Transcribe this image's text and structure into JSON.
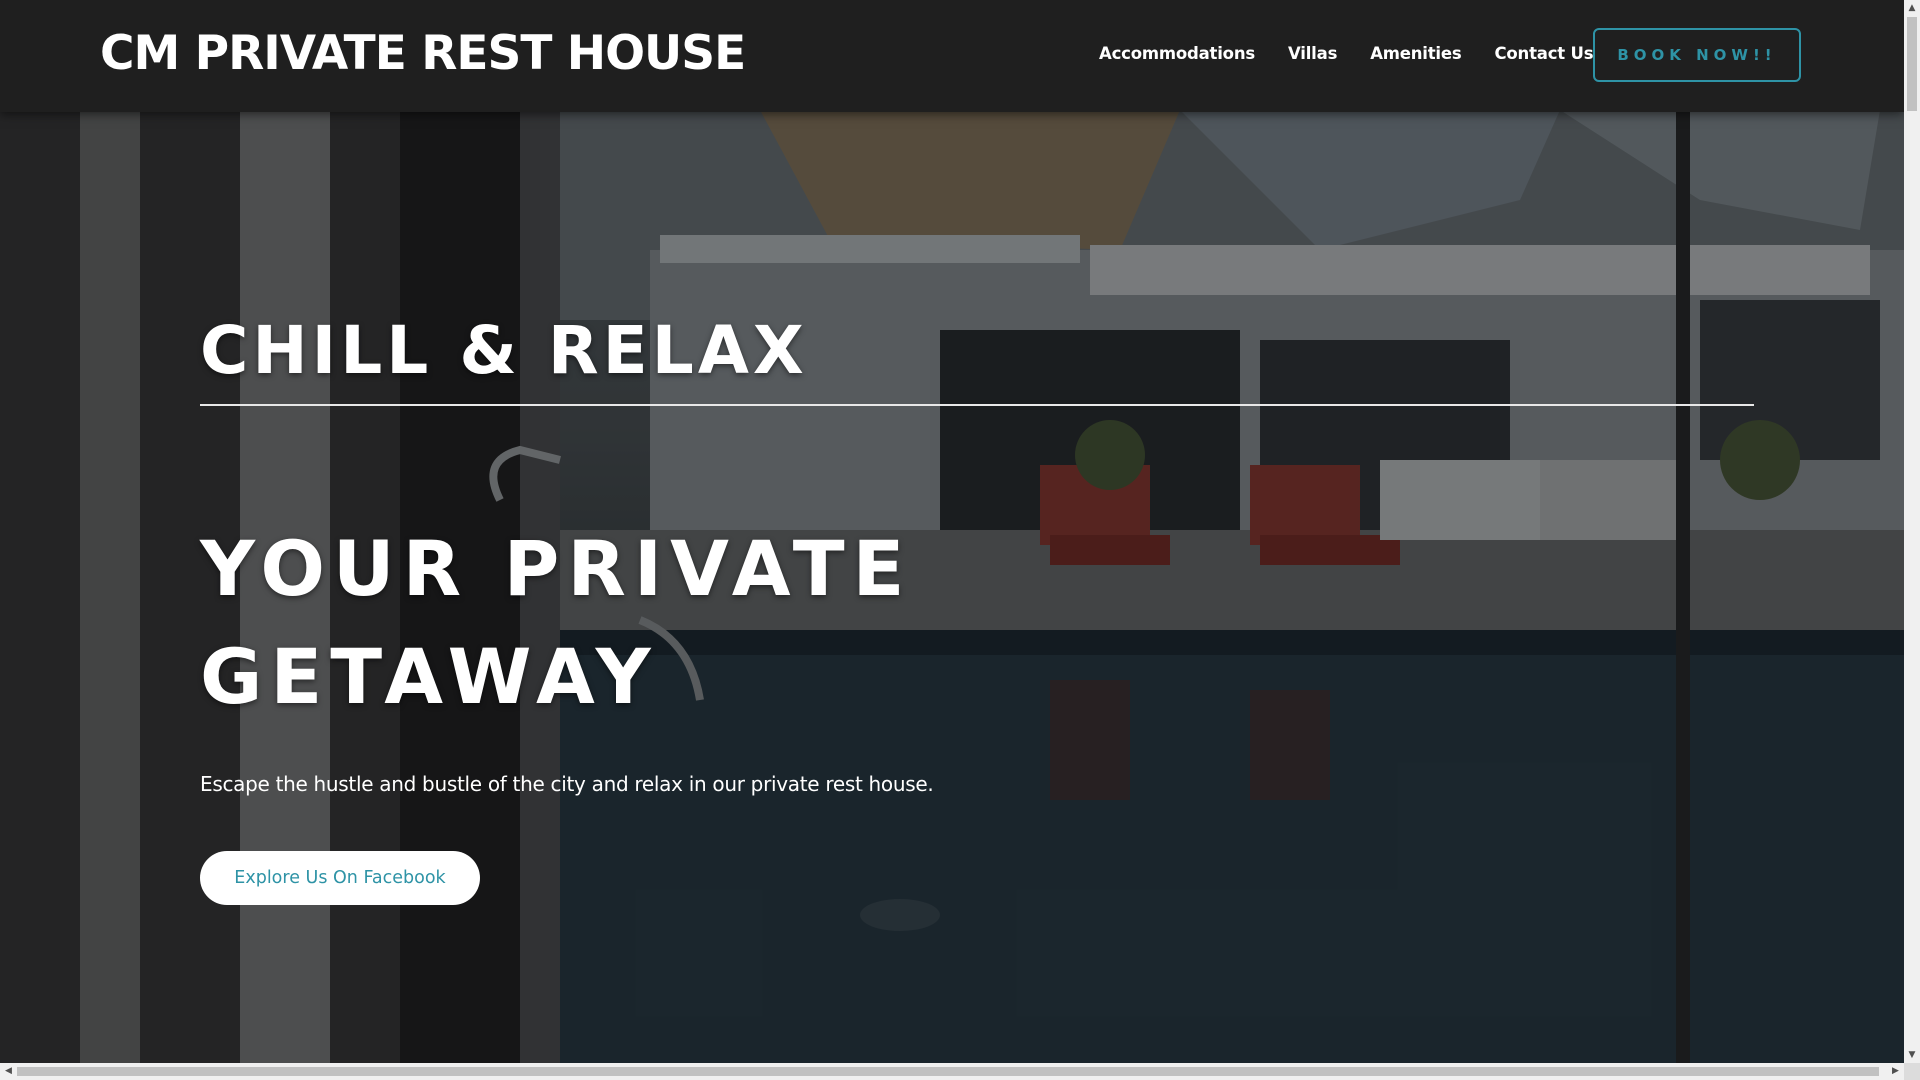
{
  "header": {
    "brand": "CM PRIVATE REST HOUSE",
    "nav": [
      {
        "label": "Accommodations"
      },
      {
        "label": "Villas"
      },
      {
        "label": "Amenities"
      },
      {
        "label": "Contact Us"
      }
    ],
    "book_label": "BOOK NOW!!"
  },
  "hero": {
    "kicker": "CHILL & RELAX",
    "headline": "YOUR PRIVATE GETAWAY",
    "tagline": "Escape the hustle and bustle of the city and relax in our private rest house.",
    "cta_label": "Explore Us On Facebook"
  },
  "colors": {
    "accent": "#2e93a6",
    "header_bg": "#1f1f1f",
    "text": "#ffffff"
  },
  "icons": {
    "scroll_up": "triangle-up",
    "scroll_down": "triangle-down",
    "scroll_left": "triangle-left",
    "scroll_right": "triangle-right"
  }
}
